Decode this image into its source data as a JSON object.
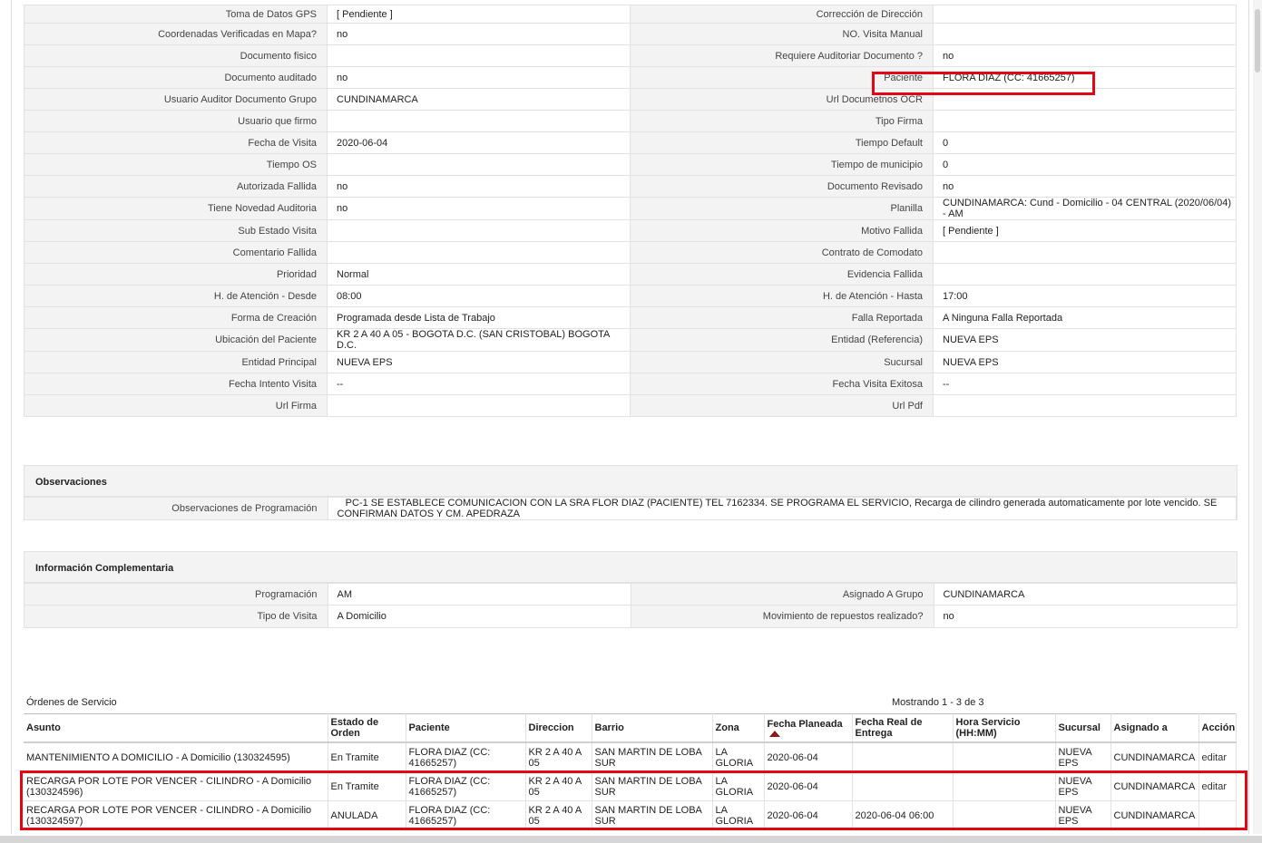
{
  "detail": [
    {
      "l1": "Toma de Datos GPS",
      "v1": "[ Pendiente ]",
      "l2": "Corrección de Dirección",
      "v2": ""
    },
    {
      "l1": "Coordenadas Verificadas en Mapa?",
      "v1": " no",
      "l2": "NO. Visita Manual",
      "v2": ""
    },
    {
      "l1": "Documento fisico",
      "v1": "",
      "l2": "Requiere Auditoriar Documento ?",
      "v2": " no"
    },
    {
      "l1": "Documento auditado",
      "v1": " no",
      "l2": "Paciente",
      "v2": "FLORA DIAZ (CC: 41665257)"
    },
    {
      "l1": "Usuario Auditor Documento Grupo",
      "v1": "CUNDINAMARCA",
      "l2": "Url Documetnos OCR",
      "v2": ""
    },
    {
      "l1": "Usuario que firmo",
      "v1": "",
      "l2": "Tipo Firma",
      "v2": ""
    },
    {
      "l1": "Fecha de Visita",
      "v1": " 2020-06-04",
      "l2": "Tiempo Default",
      "v2": "0"
    },
    {
      "l1": "Tiempo OS",
      "v1": "",
      "l2": "Tiempo de municipio",
      "v2": "0"
    },
    {
      "l1": "Autorizada Fallida",
      "v1": " no",
      "l2": "Documento Revisado",
      "v2": " no"
    },
    {
      "l1": "Tiene Novedad Auditoria",
      "v1": " no",
      "l2": "Planilla",
      "v2": "CUNDINAMARCA: Cund - Domicilio - 04 CENTRAL (2020/06/04) - AM"
    },
    {
      "l1": "Sub Estado Visita",
      "v1": "",
      "l2": "Motivo Fallida",
      "v2": "[ Pendiente ]"
    },
    {
      "l1": "Comentario Fallida",
      "v1": "",
      "l2": "Contrato de Comodato",
      "v2": ""
    },
    {
      "l1": "Prioridad",
      "v1": "Normal",
      "l2": "Evidencia Fallida",
      "v2": ""
    },
    {
      "l1": "H. de Atención - Desde",
      "v1": "08:00",
      "l2": "H. de Atención - Hasta",
      "v2": "17:00"
    },
    {
      "l1": "Forma de Creación",
      "v1": "Programada desde Lista de Trabajo",
      "l2": "Falla Reportada",
      "v2": "A Ninguna Falla Reportada"
    },
    {
      "l1": "Ubicación del Paciente",
      "v1": "KR 2 A 40 A 05 - BOGOTA D.C. (SAN CRISTOBAL) BOGOTA D.C.",
      "l2": "Entidad (Referencia)",
      "v2": "NUEVA EPS"
    },
    {
      "l1": "Entidad Principal",
      "v1": "NUEVA EPS",
      "l2": "Sucursal",
      "v2": "NUEVA EPS"
    },
    {
      "l1": "Fecha Intento Visita",
      "v1": " --",
      "l2": "Fecha Visita Exitosa",
      "v2": " --"
    },
    {
      "l1": "Url Firma",
      "v1": "",
      "l2": "Url Pdf",
      "v2": ""
    }
  ],
  "observaciones": {
    "title": "Observaciones",
    "label": "Observaciones de Programación",
    "value": "PC-1 SE ESTABLECE COMUNICACION CON LA SRA FLOR DIAZ (PACIENTE) TEL 7162334. SE PROGRAMA EL SERVICIO, Recarga de cilindro generada automaticamente por lote vencido. SE CONFIRMAN DATOS Y CM. APEDRAZA"
  },
  "complementaria": {
    "title": "Información Complementaria",
    "rows": [
      {
        "l1": "Programación",
        "v1": "AM",
        "l2": "Asignado A Grupo",
        "v2": "CUNDINAMARCA"
      },
      {
        "l1": "Tipo de Visita",
        "v1": "A Domicilio",
        "l2": "Movimiento de repuestos realizado?",
        "v2": " no"
      }
    ]
  },
  "orders": {
    "title": "Órdenes de Servicio",
    "count": "Mostrando 1 - 3 de 3",
    "headers": [
      "Asunto",
      "Estado de Orden",
      "Paciente",
      "Direccion",
      "Barrio",
      "Zona",
      "Fecha Planeada",
      "Fecha Real de Entrega",
      "Hora Servicio (HH:MM)",
      "Sucursal",
      "Asignado a",
      "Acción"
    ],
    "rows": [
      [
        "MANTENIMIENTO A DOMICILIO - A Domicilio (130324595)",
        "En Tramite",
        "FLORA DIAZ (CC: 41665257)",
        "KR 2 A 40 A 05",
        "SAN MARTIN DE LOBA SUR",
        "LA GLORIA",
        "2020-06-04",
        "",
        "",
        "NUEVA EPS",
        "CUNDINAMARCA",
        "editar"
      ],
      [
        "RECARGA POR LOTE POR VENCER - CILINDRO - A Domicilio (130324596)",
        "En Tramite",
        "FLORA DIAZ (CC: 41665257)",
        "KR 2 A 40 A 05",
        "SAN MARTIN DE LOBA SUR",
        "LA GLORIA",
        "2020-06-04",
        "",
        "",
        "NUEVA EPS",
        "CUNDINAMARCA",
        "editar"
      ],
      [
        "RECARGA POR LOTE POR VENCER - CILINDRO - A Domicilio (130324597)",
        "ANULADA",
        "FLORA DIAZ (CC: 41665257)",
        "KR 2 A 40 A 05",
        "SAN MARTIN DE LOBA SUR",
        "LA GLORIA",
        "2020-06-04",
        "2020-06-04 06:00",
        "",
        "NUEVA EPS",
        "CUNDINAMARCA",
        ""
      ]
    ]
  },
  "colors": {
    "highlight": "#e30613",
    "label_bg": "#f3f3f3",
    "border": "#e2e2e2",
    "sort_arrow": "#8b1a1a"
  }
}
